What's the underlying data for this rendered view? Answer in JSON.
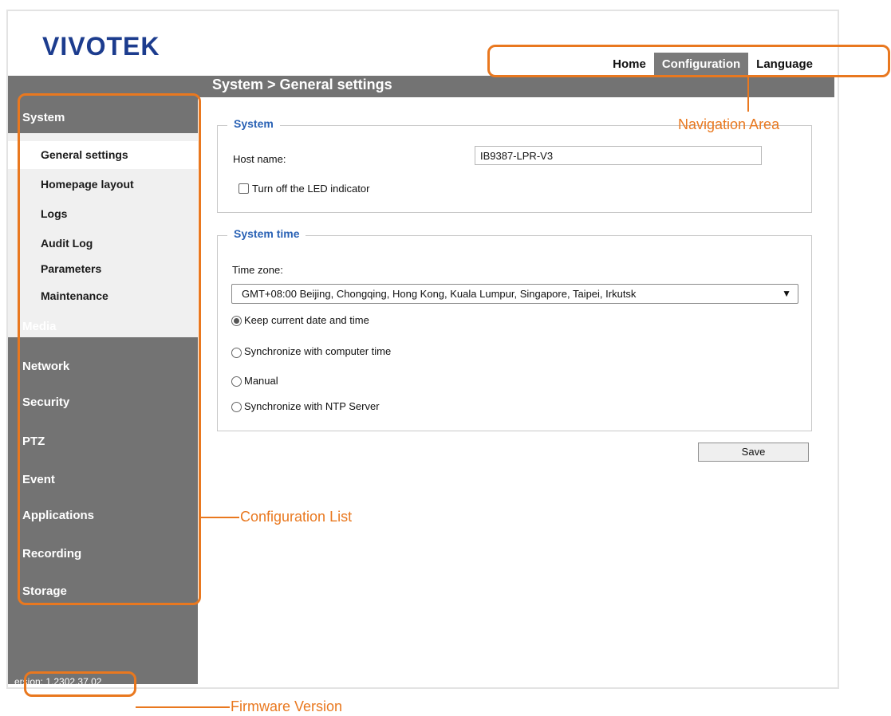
{
  "brand": {
    "logo_text": "VIVOTEK"
  },
  "topnav": {
    "items": [
      "Home",
      "Configuration",
      "Language"
    ],
    "active": "Configuration"
  },
  "breadcrumb": "System  > General settings",
  "sidebar": {
    "categories": [
      "System",
      "Media",
      "Network",
      "Security",
      "PTZ",
      "Event",
      "Applications",
      "Recording",
      "Storage"
    ],
    "system_submenu": [
      "General settings",
      "Homepage layout",
      "Logs",
      "Audit Log",
      "Parameters",
      "Maintenance"
    ],
    "active_submenu": "General settings",
    "version": "ersion: 1.2302.37.02"
  },
  "system_section": {
    "legend": "System",
    "host_label": "Host name:",
    "host_value": "IB9387-LPR-V3",
    "led_label": "Turn off the LED indicator",
    "led_checked": false
  },
  "time_section": {
    "legend": "System time",
    "tz_label": "Time zone:",
    "tz_value": "GMT+08:00 Beijing, Chongqing, Hong Kong, Kuala Lumpur, Singapore, Taipei, Irkutsk",
    "options": [
      "Keep current date and time",
      "Synchronize with computer time",
      "Manual",
      "Synchronize with NTP Server"
    ],
    "selected_option": "Keep current date and time"
  },
  "save_label": "Save",
  "annotations": {
    "navigation": "Navigation Area",
    "config_list": "Configuration List",
    "firmware": "Firmware Version",
    "color": "#e9781f"
  }
}
